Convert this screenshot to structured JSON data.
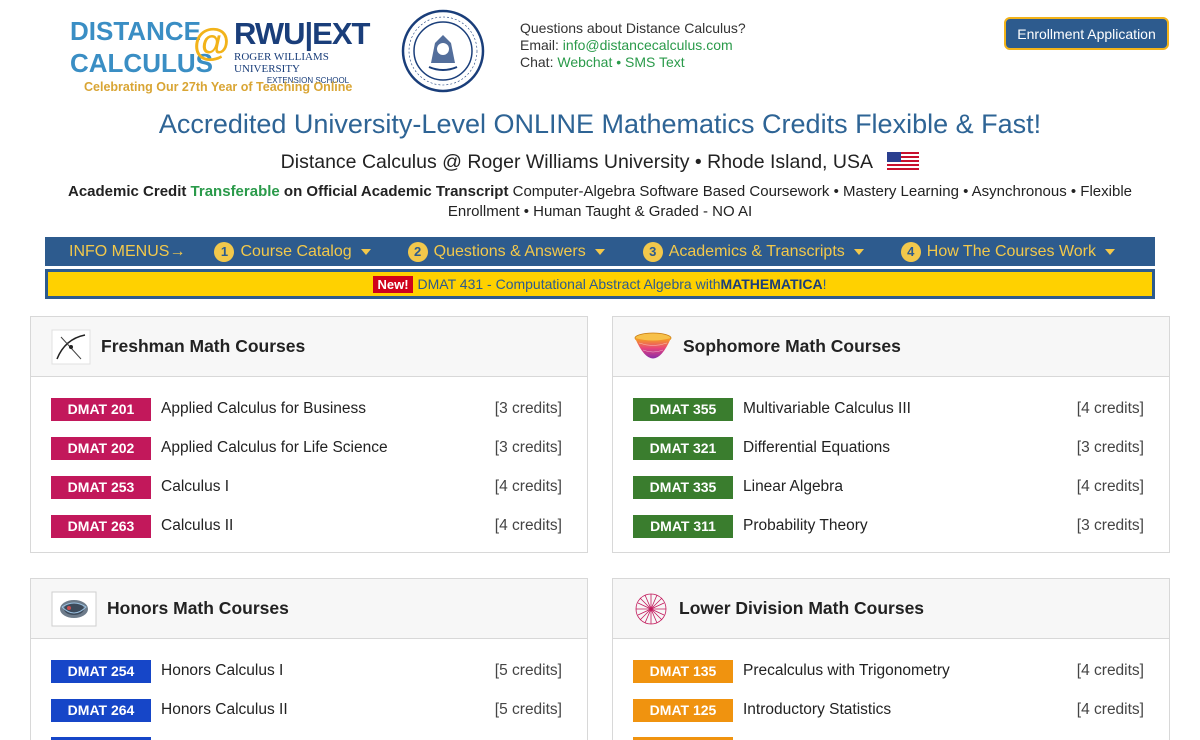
{
  "header": {
    "logo_left_text_1": "DISTANCE",
    "logo_left_text_2": "CALCULUS",
    "logo_at": "@",
    "logo_rwu": "RWU",
    "logo_ext": "EXT",
    "logo_rwu_sub": "ROGER WILLIAMS UNIVERSITY",
    "logo_rwu_sub2": "EXTENSION SCHOOL",
    "tagline": "Celebrating Our 27th Year of Teaching Online",
    "contact_question": "Questions about Distance Calculus?",
    "email_label": "Email: ",
    "email_link": "info@distancecalculus.com",
    "chat_label": "Chat: ",
    "chat_link_1": "Webchat",
    "chat_sep": " • ",
    "chat_link_2": "SMS Text",
    "enroll_button": "Enrollment Application"
  },
  "title": {
    "main": "Accredited University-Level ONLINE Mathematics Credits Flexible & Fast!",
    "sub": "Distance Calculus @ Roger Williams University • Rhode Island, USA"
  },
  "features": {
    "part1": "Academic Credit ",
    "part2": "Transferable",
    "part3": "  on Official Academic Transcript",
    "part4": "  Computer-Algebra Software Based Coursework  •  Mastery Learning • Asynchronous • Flexible Enrollment • Human Taught & Graded - NO AI"
  },
  "nav": {
    "info_menus": "INFO MENUS→",
    "items": [
      {
        "num": "1",
        "label": "Course Catalog"
      },
      {
        "num": "2",
        "label": "Questions & Answers"
      },
      {
        "num": "3",
        "label": "Academics & Transcripts"
      },
      {
        "num": "4",
        "label": "How The Courses Work"
      }
    ]
  },
  "announce": {
    "badge": "New!",
    "text": "DMAT 431 - Computational Abstract Algebra with ",
    "bold": "MATHEMATICA",
    "end": "!"
  },
  "cards": [
    {
      "title": "Freshman Math Courses",
      "color": "#c2185b",
      "courses": [
        {
          "code": "DMAT 201",
          "name": "Applied Calculus for Business",
          "credits": "[3 credits]"
        },
        {
          "code": "DMAT 202",
          "name": "Applied Calculus for Life Science",
          "credits": "[3 credits]"
        },
        {
          "code": "DMAT 253",
          "name": "Calculus I",
          "credits": "[4 credits]"
        },
        {
          "code": "DMAT 263",
          "name": "Calculus II",
          "credits": "[4 credits]"
        }
      ]
    },
    {
      "title": "Sophomore Math Courses",
      "color": "#3a7d2e",
      "courses": [
        {
          "code": "DMAT 355",
          "name": "Multivariable Calculus III",
          "credits": "[4 credits]"
        },
        {
          "code": "DMAT 321",
          "name": "Differential Equations",
          "credits": "[3 credits]"
        },
        {
          "code": "DMAT 335",
          "name": "Linear Algebra",
          "credits": "[4 credits]"
        },
        {
          "code": "DMAT 311",
          "name": "Probability Theory",
          "credits": "[3 credits]"
        }
      ]
    },
    {
      "title": "Honors Math Courses",
      "color": "#1646c8",
      "courses": [
        {
          "code": "DMAT 254",
          "name": "Honors Calculus I",
          "credits": "[5 credits]"
        },
        {
          "code": "DMAT 264",
          "name": "Honors Calculus II",
          "credits": "[5 credits]"
        }
      ]
    },
    {
      "title": "Lower Division Math Courses",
      "color": "#f0930f",
      "courses": [
        {
          "code": "DMAT 135",
          "name": "Precalculus with Trigonometry",
          "credits": "[4 credits]"
        },
        {
          "code": "DMAT 125",
          "name": "Introductory Statistics",
          "credits": "[4 credits]"
        }
      ]
    }
  ]
}
